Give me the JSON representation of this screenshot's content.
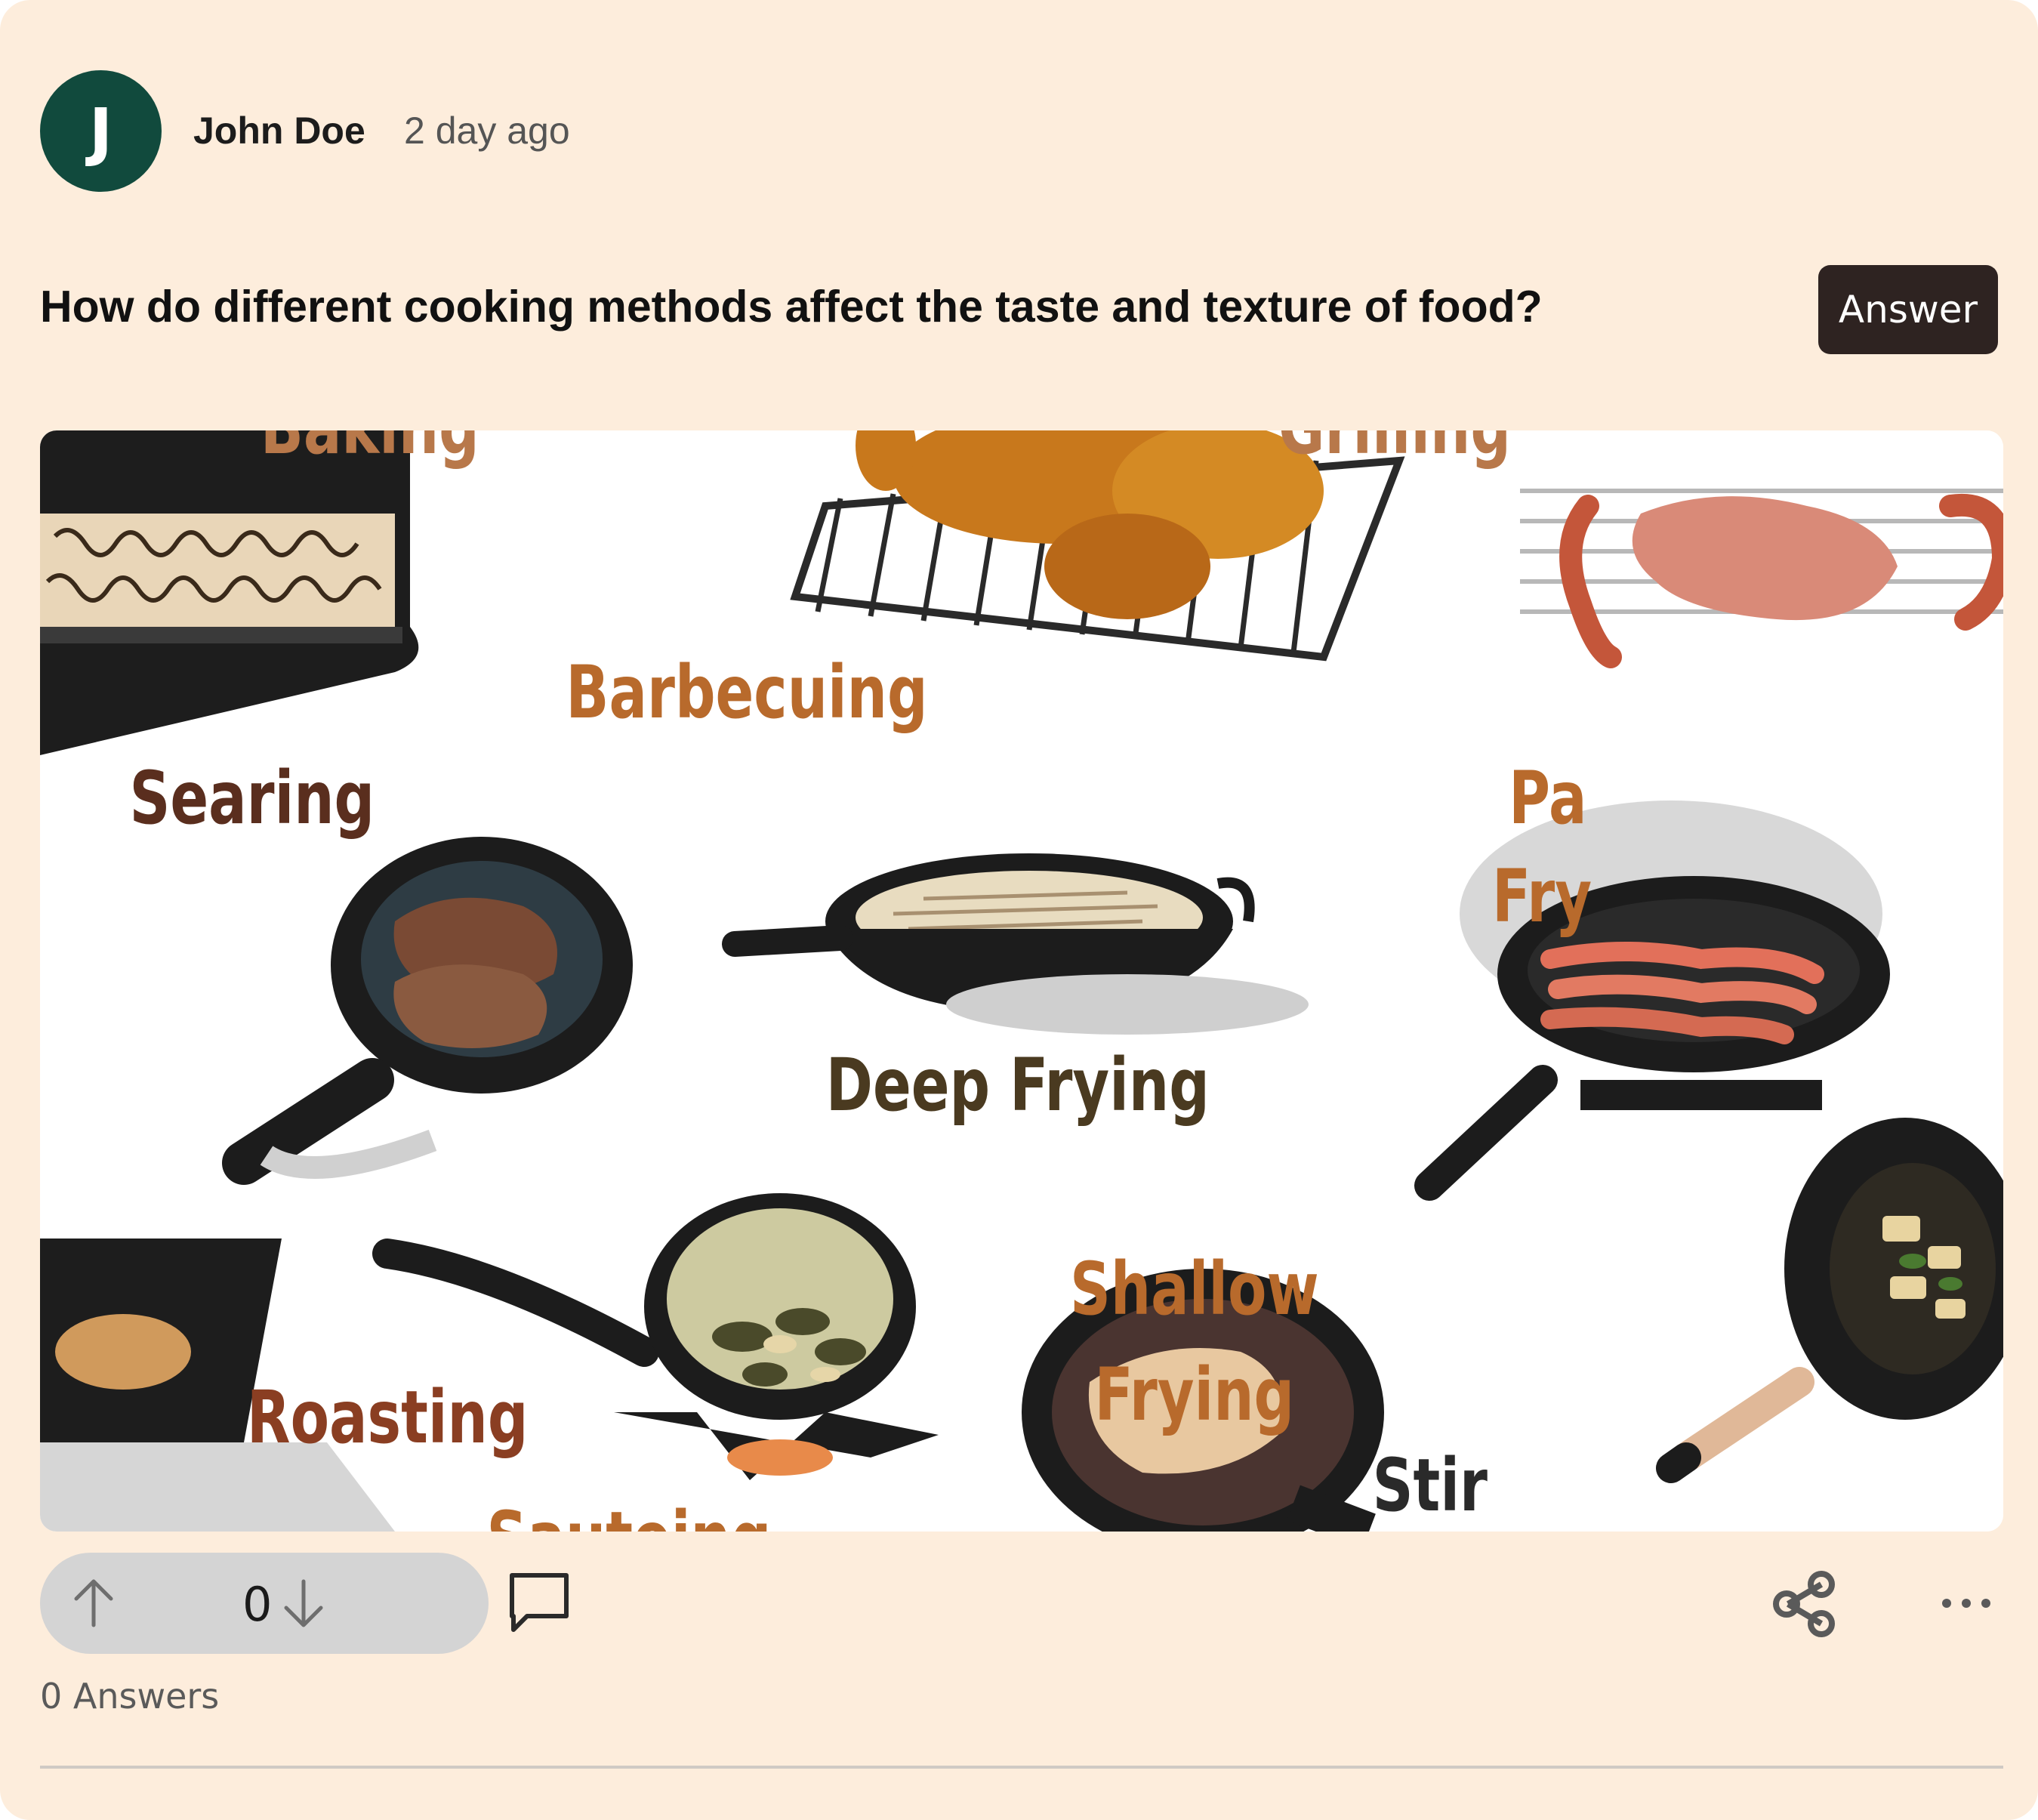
{
  "post": {
    "author": {
      "initial": "J",
      "name": "John Doe",
      "time_ago": "2 day ago"
    },
    "question": "How do different cooking methods affect the taste and texture of food?",
    "answer_button_label": "Answer",
    "image": {
      "labels": {
        "baking": "Baking",
        "barbecuing": "Barbecuing",
        "grilling": "Grilling",
        "searing": "Searing",
        "deep_frying": "Deep Frying",
        "pan_frying_1": "Pa",
        "pan_frying_2": "Fry",
        "shallow_frying_1": "Shallow",
        "shallow_frying_2": "Frying",
        "roasting": "Roasting",
        "sauteing": "Sauteing",
        "stir": "Stir"
      }
    },
    "votes": {
      "count": "0"
    },
    "answers_summary": "0 Answers"
  },
  "icons": {
    "upvote": "arrow-up-icon",
    "downvote": "arrow-down-icon",
    "comment": "comment-icon",
    "share": "share-icon",
    "more": "more-options-icon"
  },
  "colors": {
    "card_background": "#fdeddc",
    "avatar": "#114a3d",
    "answer_button": "#2e2321",
    "vote_pill": "#d4d4d4",
    "label_orange": "#b86a2c",
    "label_brown": "#5a2e1e",
    "label_olive": "#4a3a20"
  }
}
